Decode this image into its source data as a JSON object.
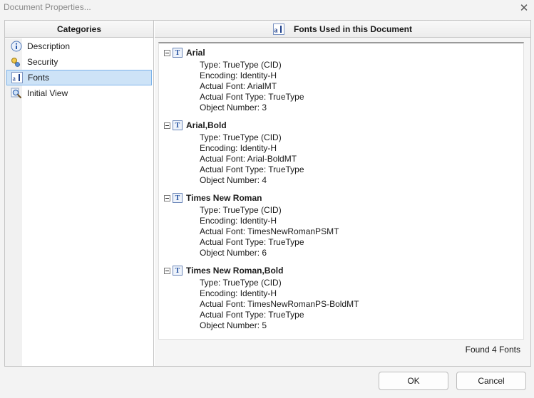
{
  "window": {
    "title": "Document Properties...",
    "close_glyph": "✕"
  },
  "categories": {
    "header": "Categories",
    "items": [
      {
        "label": "Description",
        "icon": "info-icon",
        "selected": false
      },
      {
        "label": "Security",
        "icon": "key-icon",
        "selected": false
      },
      {
        "label": "Fonts",
        "icon": "font-icon",
        "selected": true
      },
      {
        "label": "Initial View",
        "icon": "magnifier-icon",
        "selected": false
      }
    ]
  },
  "fonts_panel": {
    "header": "Fonts Used in this Document",
    "header_icon": "font-icon",
    "fonts": [
      {
        "name": "Arial",
        "properties": [
          "Type: TrueType (CID)",
          "Encoding: Identity-H",
          "Actual Font: ArialMT",
          "Actual Font Type: TrueType",
          "Object Number: 3"
        ]
      },
      {
        "name": "Arial,Bold",
        "properties": [
          "Type: TrueType (CID)",
          "Encoding: Identity-H",
          "Actual Font: Arial-BoldMT",
          "Actual Font Type: TrueType",
          "Object Number: 4"
        ]
      },
      {
        "name": "Times New Roman",
        "properties": [
          "Type: TrueType (CID)",
          "Encoding: Identity-H",
          "Actual Font: TimesNewRomanPSMT",
          "Actual Font Type: TrueType",
          "Object Number: 6"
        ]
      },
      {
        "name": "Times New Roman,Bold",
        "properties": [
          "Type: TrueType (CID)",
          "Encoding: Identity-H",
          "Actual Font: TimesNewRomanPS-BoldMT",
          "Actual Font Type: TrueType",
          "Object Number: 5"
        ]
      }
    ],
    "status": "Found 4 Fonts",
    "truetype_icon_glyph": "T"
  },
  "buttons": {
    "ok": "OK",
    "cancel": "Cancel"
  },
  "colors": {
    "selection_bg": "#cde3f7",
    "selection_border": "#7eb4ea"
  }
}
